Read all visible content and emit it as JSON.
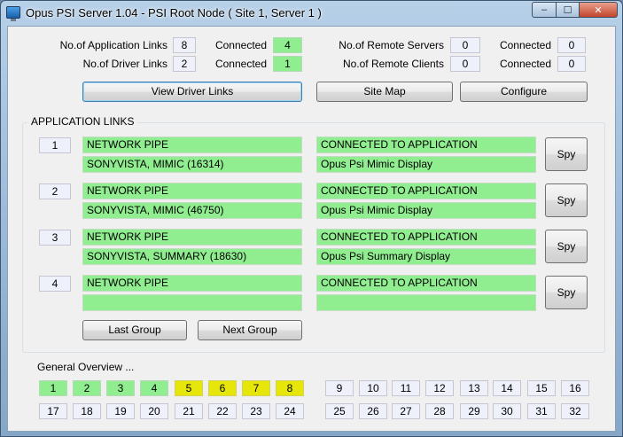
{
  "window": {
    "title": "Opus PSI Server 1.04 - PSI Root Node ( Site 1, Server 1 )",
    "min_label": "–",
    "max_label": "☐",
    "close_label": "✕"
  },
  "stats": {
    "app_links_label": "No.of Application Links",
    "app_links_value": "8",
    "app_connected_label": "Connected",
    "app_connected_value": "4",
    "driver_links_label": "No.of Driver Links",
    "driver_links_value": "2",
    "driver_connected_label": "Connected",
    "driver_connected_value": "1",
    "remote_servers_label": "No.of Remote Servers",
    "remote_servers_value": "0",
    "servers_connected_label": "Connected",
    "servers_connected_value": "0",
    "remote_clients_label": "No.of Remote Clients",
    "remote_clients_value": "0",
    "clients_connected_label": "Connected",
    "clients_connected_value": "0"
  },
  "buttons": {
    "view_driver_links": "View Driver Links",
    "site_map": "Site Map",
    "configure": "Configure",
    "last_group": "Last Group",
    "next_group": "Next Group",
    "spy": "Spy"
  },
  "app_links": {
    "title": "APPLICATION LINKS",
    "rows": [
      {
        "num": "1",
        "link_type": "NETWORK PIPE",
        "source": "SONYVISTA, MIMIC  (16314)",
        "status": "CONNECTED TO APPLICATION",
        "app_name": "Opus Psi Mimic Display"
      },
      {
        "num": "2",
        "link_type": "NETWORK PIPE",
        "source": "SONYVISTA, MIMIC  (46750)",
        "status": "CONNECTED TO APPLICATION",
        "app_name": "Opus Psi Mimic Display"
      },
      {
        "num": "3",
        "link_type": "NETWORK PIPE",
        "source": "SONYVISTA, SUMMARY  (18630)",
        "status": "CONNECTED TO APPLICATION",
        "app_name": "Opus Psi Summary Display"
      },
      {
        "num": "4",
        "link_type": "NETWORK PIPE",
        "source": "",
        "status": "CONNECTED TO APPLICATION",
        "app_name": ""
      }
    ]
  },
  "overview": {
    "title": "General Overview ...",
    "colors": {
      "connected": "#90ee90",
      "warning": "#e6e60a",
      "idle": "#eef0fa"
    },
    "cells": [
      {
        "n": "1",
        "state": "connected"
      },
      {
        "n": "2",
        "state": "connected"
      },
      {
        "n": "3",
        "state": "connected"
      },
      {
        "n": "4",
        "state": "connected"
      },
      {
        "n": "5",
        "state": "warning"
      },
      {
        "n": "6",
        "state": "warning"
      },
      {
        "n": "7",
        "state": "warning"
      },
      {
        "n": "8",
        "state": "warning"
      },
      {
        "n": "9",
        "state": "idle"
      },
      {
        "n": "10",
        "state": "idle"
      },
      {
        "n": "11",
        "state": "idle"
      },
      {
        "n": "12",
        "state": "idle"
      },
      {
        "n": "13",
        "state": "idle"
      },
      {
        "n": "14",
        "state": "idle"
      },
      {
        "n": "15",
        "state": "idle"
      },
      {
        "n": "16",
        "state": "idle"
      },
      {
        "n": "17",
        "state": "idle"
      },
      {
        "n": "18",
        "state": "idle"
      },
      {
        "n": "19",
        "state": "idle"
      },
      {
        "n": "20",
        "state": "idle"
      },
      {
        "n": "21",
        "state": "idle"
      },
      {
        "n": "22",
        "state": "idle"
      },
      {
        "n": "23",
        "state": "idle"
      },
      {
        "n": "24",
        "state": "idle"
      },
      {
        "n": "25",
        "state": "idle"
      },
      {
        "n": "26",
        "state": "idle"
      },
      {
        "n": "27",
        "state": "idle"
      },
      {
        "n": "28",
        "state": "idle"
      },
      {
        "n": "29",
        "state": "idle"
      },
      {
        "n": "30",
        "state": "idle"
      },
      {
        "n": "31",
        "state": "idle"
      },
      {
        "n": "32",
        "state": "idle"
      }
    ]
  }
}
